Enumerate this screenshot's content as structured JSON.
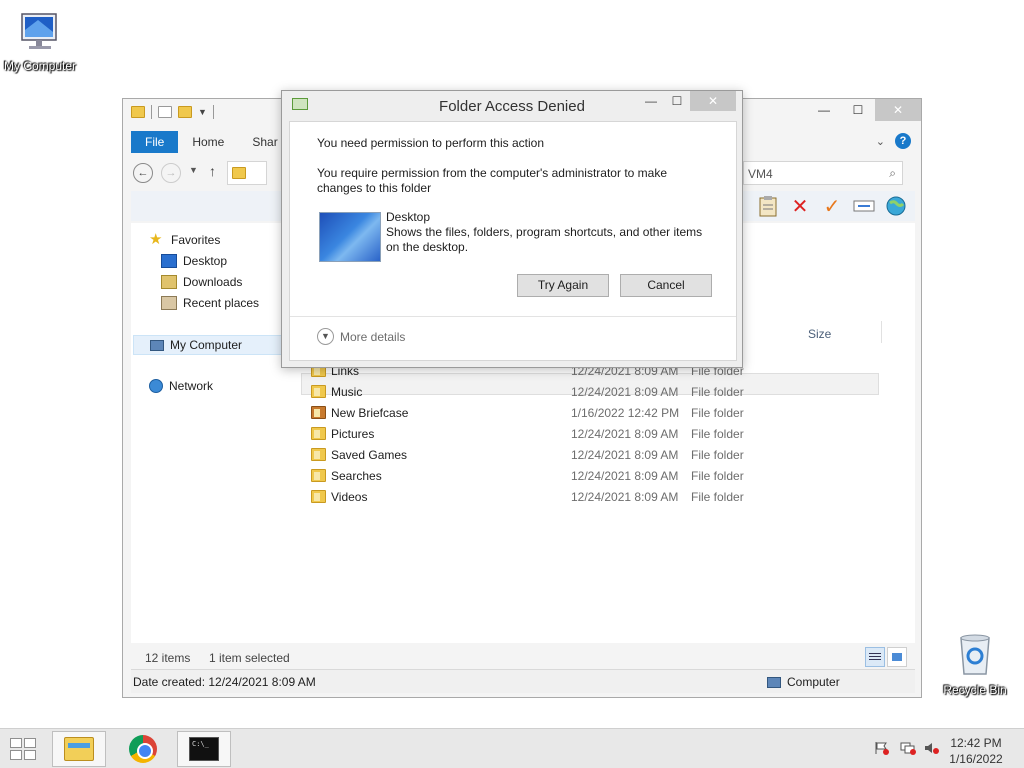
{
  "desktop": {
    "my_computer_label": "My Computer",
    "recycle_bin_label": "Recycle Bin"
  },
  "explorer": {
    "tabs": {
      "file": "File",
      "home": "Home",
      "share": "Shar"
    },
    "search_text": "VM4",
    "nav": {
      "favorites": "Favorites",
      "desktop": "Desktop",
      "downloads": "Downloads",
      "recent_places": "Recent places",
      "my_computer": "My Computer",
      "network": "Network"
    },
    "size_header": "Size",
    "rows": [
      {
        "name": "Links",
        "date": "12/24/2021 8:09 AM",
        "type": "File folder",
        "icon": "folder-icon"
      },
      {
        "name": "Music",
        "date": "12/24/2021 8:09 AM",
        "type": "File folder",
        "icon": "music-folder-icon"
      },
      {
        "name": "New Briefcase",
        "date": "1/16/2022 12:42 PM",
        "type": "File folder",
        "icon": "briefcase-icon"
      },
      {
        "name": "Pictures",
        "date": "12/24/2021 8:09 AM",
        "type": "File folder",
        "icon": "pictures-folder-icon"
      },
      {
        "name": "Saved Games",
        "date": "12/24/2021 8:09 AM",
        "type": "File folder",
        "icon": "games-folder-icon"
      },
      {
        "name": "Searches",
        "date": "12/24/2021 8:09 AM",
        "type": "File folder",
        "icon": "search-folder-icon"
      },
      {
        "name": "Videos",
        "date": "12/24/2021 8:09 AM",
        "type": "File folder",
        "icon": "videos-folder-icon"
      }
    ],
    "status": {
      "items": "12 items",
      "selected": "1 item selected"
    },
    "details": {
      "date_created": "Date created: 12/24/2021 8:09 AM",
      "location": "Computer"
    }
  },
  "dialog": {
    "title": "Folder Access Denied",
    "message1": "You need permission to perform this action",
    "message2": "You require permission from the computer's administrator to make changes to this folder",
    "item_name": "Desktop",
    "item_description": "Shows the files, folders, program shortcuts, and other items on the desktop.",
    "try_again": "Try Again",
    "cancel": "Cancel",
    "more_details": "More details"
  },
  "taskbar": {
    "time": "12:42 PM",
    "date": "1/16/2022"
  },
  "colors": {
    "accent": "#1979ca",
    "close_button": "#c7c7c7"
  }
}
